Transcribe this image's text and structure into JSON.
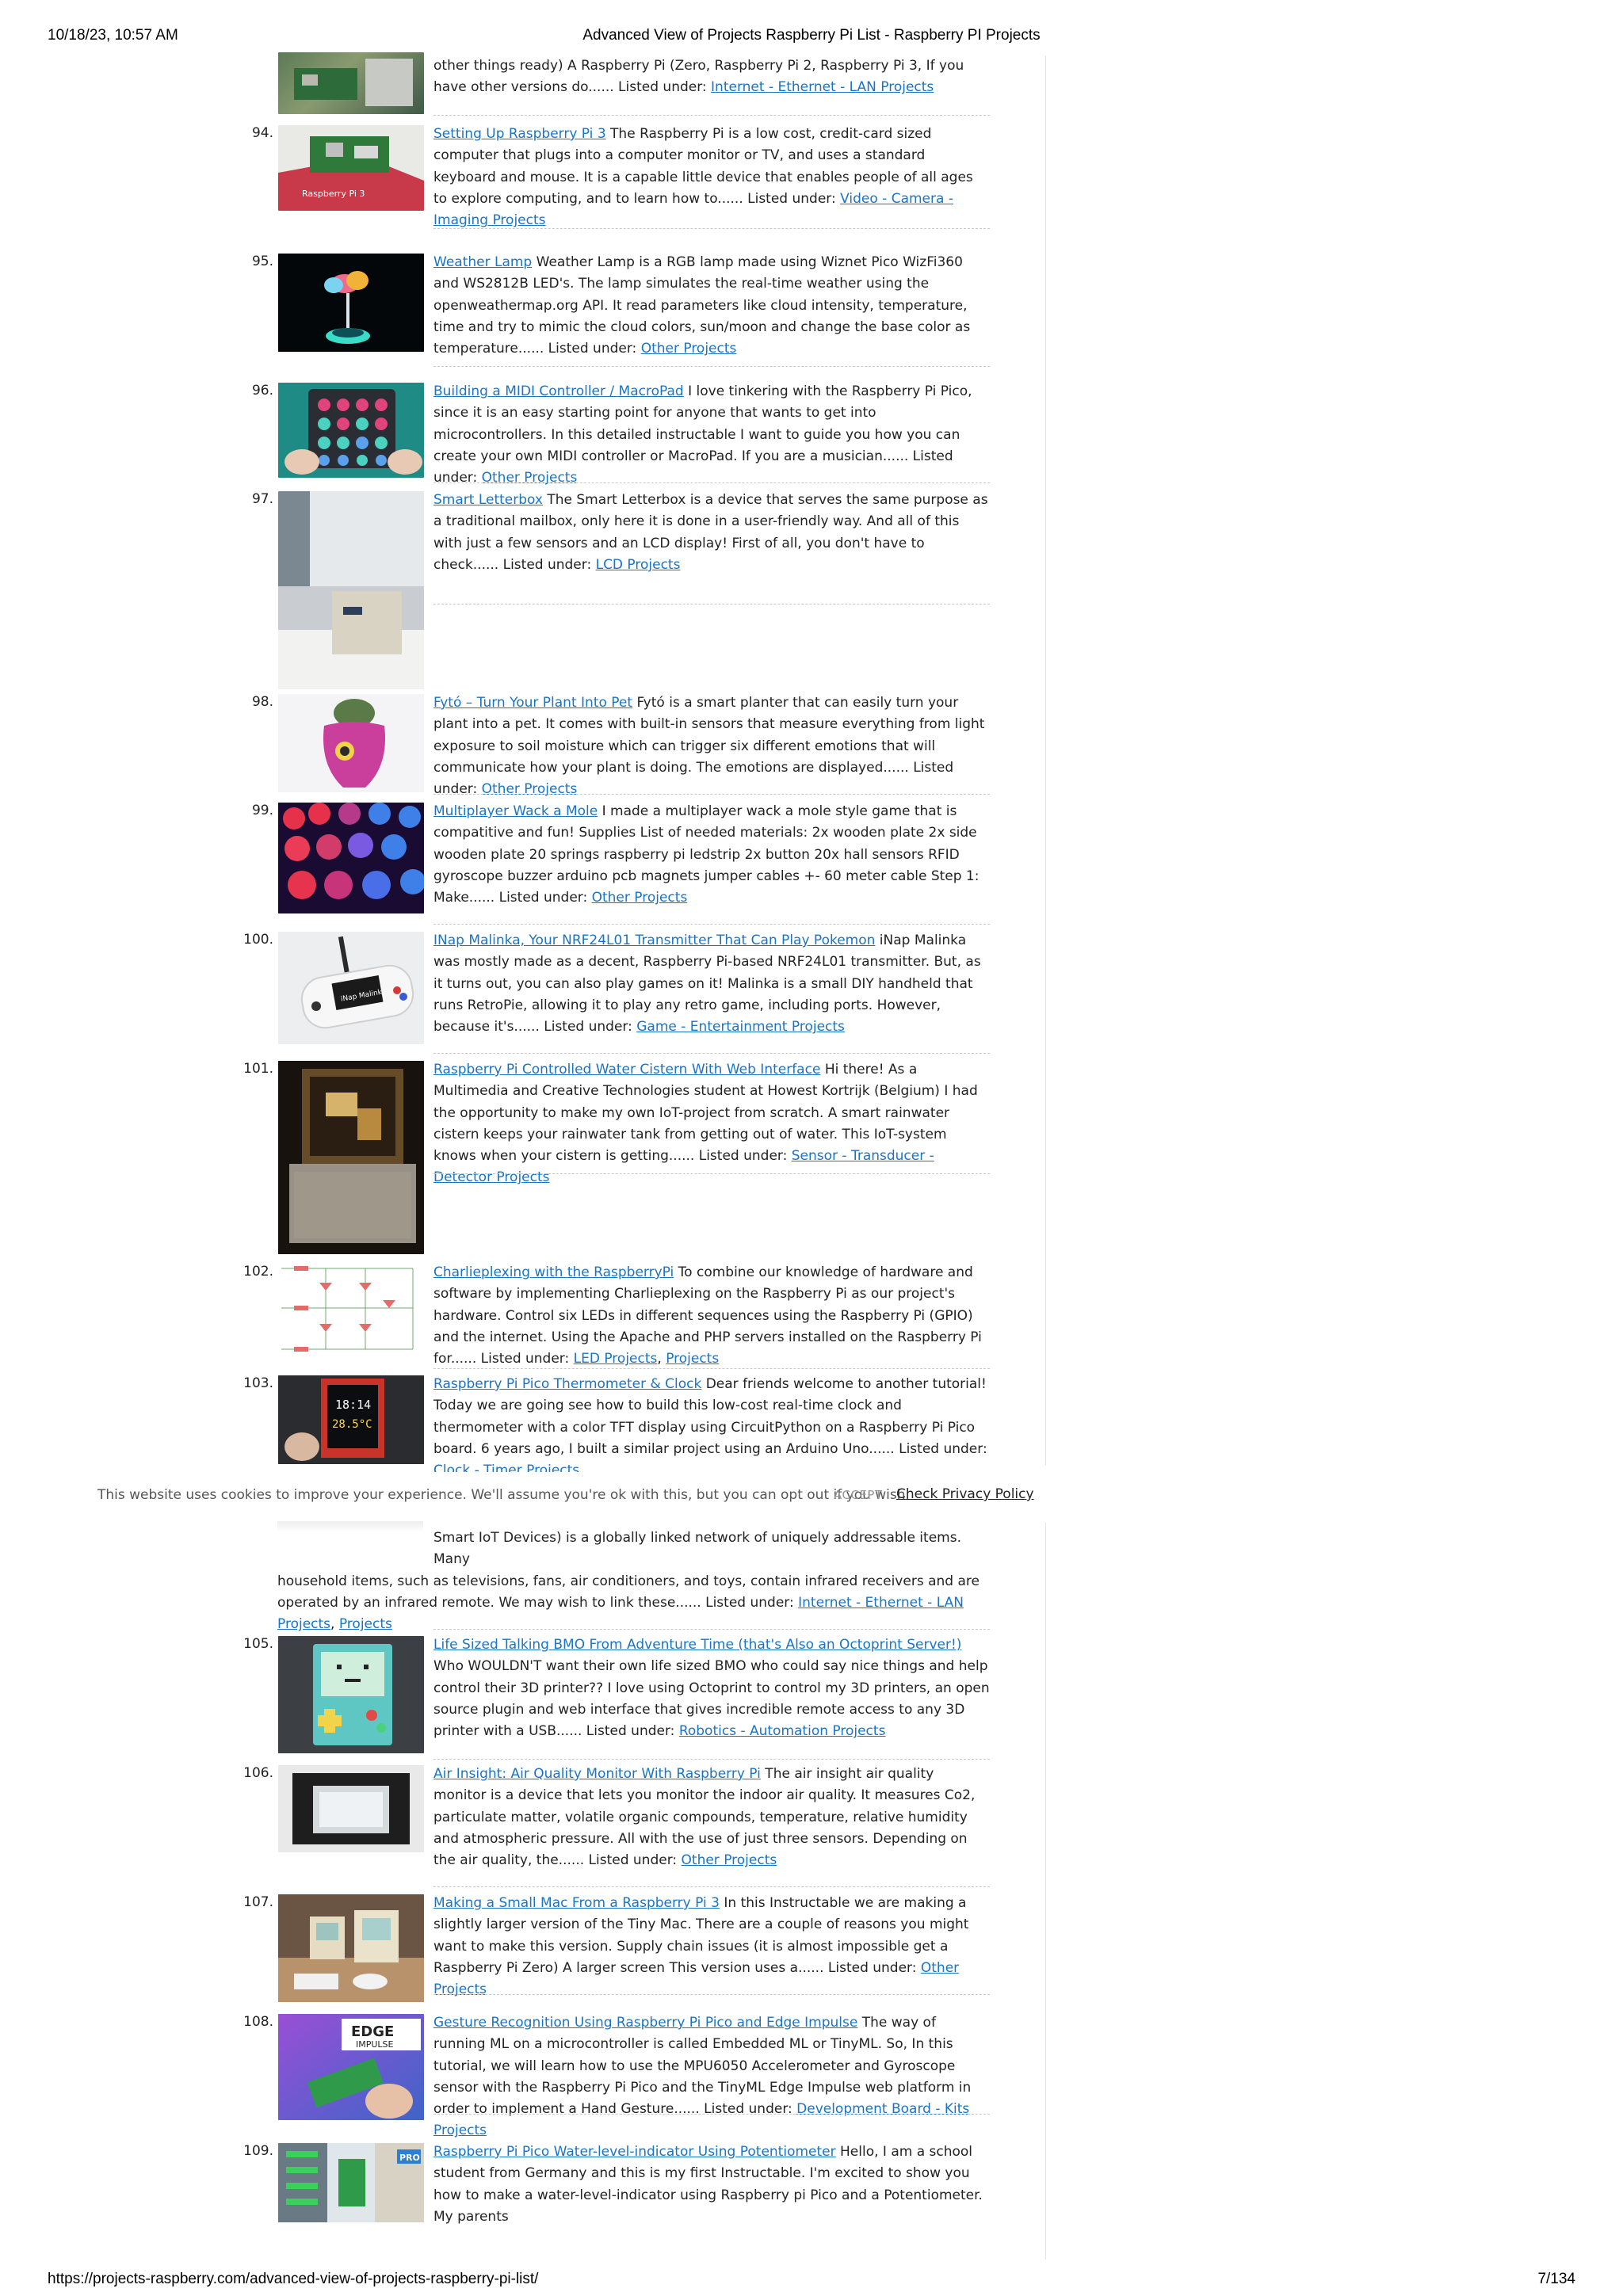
{
  "header": {
    "datetime": "10/18/23, 10:57 AM",
    "title": "Advanced View of Projects Raspberry Pi List - Raspberry PI Projects"
  },
  "footer": {
    "url": "https://projects-raspberry.com/advanced-view-of-projects-raspberry-pi-list/",
    "page": "7/134"
  },
  "top_fragment": {
    "text": "other things ready) A Raspberry Pi (Zero, Raspberry Pi 2, Raspberry Pi 3, If you have other versions do...... Listed under: ",
    "link": "Internet - Ethernet - LAN Projects"
  },
  "entries": [
    {
      "num": "94.",
      "title": "Setting Up Raspberry Pi 3",
      "text": " The Raspberry Pi is a low cost, credit-card sized computer that plugs into a computer monitor or TV, and uses a standard keyboard and mouse. It is a capable little device that enables people of all ages to explore computing, and to learn how to...... Listed under: ",
      "cats": [
        "Video - Camera - Imaging Projects"
      ],
      "thumb_label": "Raspberry Pi 3"
    },
    {
      "num": "95.",
      "title": "Weather Lamp",
      "text": " Weather Lamp is a RGB lamp made using Wiznet Pico WizFi360 and WS2812B LED's. The lamp simulates the real-time weather using the openweathermap.org API. It read parameters like cloud intensity, temperature, time and try to mimic the cloud colors, sun/moon and change the base color as temperature...... Listed under: ",
      "cats": [
        "Other Projects"
      ]
    },
    {
      "num": "96.",
      "title": "Building a MIDI Controller / MacroPad",
      "text": " I love tinkering with the Raspberry Pi Pico, since it is an easy starting point for anyone that wants to get into microcontrollers. In this detailed instructable I want to guide you how you can create your own MIDI controller or MacroPad. If you are a musician...... Listed under: ",
      "cats": [
        "Other Projects"
      ]
    },
    {
      "num": "97.",
      "title": "Smart Letterbox",
      "text": " The Smart Letterbox is a device that serves the same purpose as a traditional mailbox, only here it is done in a user-friendly way. And all of this with just a few sensors and an LCD display! First of all, you don't have to check...... Listed under: ",
      "cats": [
        "LCD Projects"
      ]
    },
    {
      "num": "98.",
      "title": "Fytó – Turn Your Plant Into Pet",
      "text": " Fytó is a smart planter that can easily turn your plant into a pet. It comes with built-in sensors that measure everything from light exposure to soil moisture which can trigger six different emotions that will communicate how your plant is doing. The emotions are displayed...... Listed under: ",
      "cats": [
        "Other Projects"
      ]
    },
    {
      "num": "99.",
      "title": "Multiplayer Wack a Mole",
      "text": " I made a multiplayer wack a mole style game that is compatitive and fun! Supplies List of needed materials: 2x wooden plate 2x side wooden plate 20 springs raspberry pi ledstrip 2x button 20x hall sensors RFID gyroscope buzzer arduino pcb magnets jumper cables +- 60 meter cable Step 1: Make...... Listed under: ",
      "cats": [
        "Other Projects"
      ]
    },
    {
      "num": "100.",
      "title": "INap Malinka, Your NRF24L01 Transmitter That Can Play Pokemon",
      "text": " iNap Malinka was mostly made as a decent, Raspberry Pi-based NRF24L01 transmitter. But, as it turns out, you can also play games on it! Malinka is a small DIY handheld that runs RetroPie, allowing it to play any retro game, including ports. However, because it's...... Listed under: ",
      "cats": [
        "Game - Entertainment Projects"
      ],
      "thumb_label": "iNap Malinka"
    },
    {
      "num": "101.",
      "title": "Raspberry Pi Controlled Water Cistern With Web Interface",
      "text": " Hi there! As a Multimedia and Creative Technologies student at Howest Kortrijk (Belgium) I had the opportunity to make my own IoT-project from scratch. A smart rainwater cistern keeps your rainwater tank from getting out of water. This IoT-system knows when your cistern is getting...... Listed under: ",
      "cats": [
        "Sensor - Transducer - Detector Projects"
      ]
    },
    {
      "num": "102.",
      "title": "Charlieplexing with the RaspberryPi",
      "text": " To combine our knowledge of hardware and software by implementing Charlieplexing on the Raspberry Pi as our project's hardware. Control six LEDs in different sequences using the Raspberry Pi (GPIO) and the internet. Using the Apache and PHP servers installed on the Raspberry Pi for...... Listed under: ",
      "cats": [
        "LED Projects",
        "Projects"
      ]
    },
    {
      "num": "103.",
      "title": "Raspberry Pi Pico Thermometer & Clock",
      "text": " Dear friends welcome to another tutorial! Today we are going see how to build this low-cost real-time clock and thermometer with a color TFT display using CircuitPython on a Raspberry Pi Pico board. 6 years ago, I built a similar project using an Arduino Uno...... Listed under: ",
      "cats": [
        "Clock - Timer Projects"
      ],
      "thumb_time": "18:14",
      "thumb_temp": "28.5°C"
    }
  ],
  "partial_entry": {
    "line1": "Smart IoT Devices) is a globally linked network of uniquely addressable items. Many",
    "rest": "household items, such as televisions, fans, air conditioners, and toys, contain infrared receivers and are operated by an infrared remote. We may wish to link these...... Listed under: ",
    "cats": [
      "Internet - Ethernet - LAN Projects",
      "Projects"
    ]
  },
  "entries2": [
    {
      "num": "105.",
      "title": "Life Sized Talking BMO From Adventure Time (that's Also an Octoprint Server!)",
      "text": " Who WOULDN'T want their own life sized BMO who could say nice things and help control their 3D printer?? I love using Octoprint to control my 3D printers, an open source plugin and web interface that gives incredible remote access to any 3D printer with a USB...... Listed under: ",
      "cats": [
        "Robotics - Automation Projects"
      ]
    },
    {
      "num": "106.",
      "title": "Air Insight: Air Quality Monitor With Raspberry Pi",
      "text": " The air insight air quality monitor is a device that lets you monitor the indoor air quality. It measures Co2, particulate matter, volatile organic compounds, temperature, relative humidity and atmospheric pressure. All with the use of just three sensors. Depending on the air quality, the...... Listed under: ",
      "cats": [
        "Other Projects"
      ]
    },
    {
      "num": "107.",
      "title": "Making a Small Mac From a Raspberry Pi 3",
      "text": " In this Instructable we are making a slightly larger version of the Tiny Mac. There are a couple of reasons you might want to make this version. Supply chain issues (it is almost impossible get a Raspberry Pi Zero) A larger screen This version uses a...... Listed under: ",
      "cats": [
        "Other Projects"
      ]
    },
    {
      "num": "108.",
      "title": "Gesture Recognition Using Raspberry Pi Pico and Edge Impulse",
      "text": " The way of running ML on a microcontroller is called Embedded ML or TinyML. So, In this tutorial, we will learn how to use the MPU6050 Accelerometer and Gyroscope sensor with the Raspberry Pi Pico and the TinyML Edge Impulse web platform in order to implement a Hand Gesture...... Listed under: ",
      "cats": [
        "Development Board - Kits Projects"
      ],
      "thumb_label1": "EDGE",
      "thumb_label2": "IMPULSE"
    },
    {
      "num": "109.",
      "title": "Raspberry Pi Pico Water-level-indicator Using Potentiometer",
      "text": " Hello, I am a school student from Germany and this is my first Instructable. I'm excited to show you how to make a water-level-indicator using Raspberry pi Pico and a Potentiometer. My parents",
      "cats": [],
      "thumb_label": "PRO"
    }
  ],
  "cookie": {
    "text": "This website uses cookies to improve your experience. We'll assume you're ok with this, but you can opt out if you wish.",
    "accept": "ACCEPT",
    "policy": "Check Privacy Policy"
  }
}
